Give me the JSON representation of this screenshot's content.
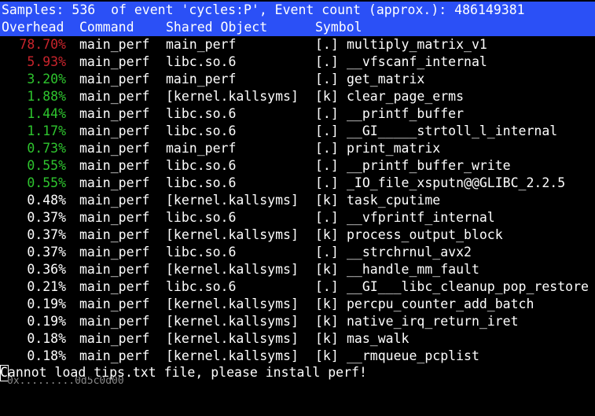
{
  "header": {
    "summary": "Samples: 536  of event 'cycles:P', Event count (approx.): 486149381"
  },
  "columns": {
    "overhead": "Overhead",
    "command": "Command",
    "shared_object": "Shared Object",
    "symbol": "Symbol"
  },
  "colors": {
    "header_bg": "#2b50f6",
    "hot": "#c8242c",
    "warm": "#2ec42e",
    "normal": "#ffffff",
    "background": "#000000"
  },
  "rows": [
    {
      "overhead": "78.70%",
      "command": "main_perf",
      "object": "main_perf",
      "level": "[.]",
      "symbol": "multiply_matrix_v1",
      "heat": "hot"
    },
    {
      "overhead": "5.93%",
      "command": "main_perf",
      "object": "libc.so.6",
      "level": "[.]",
      "symbol": "__vfscanf_internal",
      "heat": "hot"
    },
    {
      "overhead": "3.20%",
      "command": "main_perf",
      "object": "main_perf",
      "level": "[.]",
      "symbol": "get_matrix",
      "heat": "warm"
    },
    {
      "overhead": "1.88%",
      "command": "main_perf",
      "object": "[kernel.kallsyms]",
      "level": "[k]",
      "symbol": "clear_page_erms",
      "heat": "warm"
    },
    {
      "overhead": "1.44%",
      "command": "main_perf",
      "object": "libc.so.6",
      "level": "[.]",
      "symbol": "__printf_buffer",
      "heat": "warm"
    },
    {
      "overhead": "1.17%",
      "command": "main_perf",
      "object": "libc.so.6",
      "level": "[.]",
      "symbol": "__GI_____strtoll_l_internal",
      "heat": "warm"
    },
    {
      "overhead": "0.73%",
      "command": "main_perf",
      "object": "main_perf",
      "level": "[.]",
      "symbol": "print_matrix",
      "heat": "warm"
    },
    {
      "overhead": "0.55%",
      "command": "main_perf",
      "object": "libc.so.6",
      "level": "[.]",
      "symbol": "__printf_buffer_write",
      "heat": "warm"
    },
    {
      "overhead": "0.55%",
      "command": "main_perf",
      "object": "libc.so.6",
      "level": "[.]",
      "symbol": "_IO_file_xsputn@@GLIBC_2.2.5",
      "heat": "warm"
    },
    {
      "overhead": "0.48%",
      "command": "main_perf",
      "object": "[kernel.kallsyms]",
      "level": "[k]",
      "symbol": "task_cputime",
      "heat": "normal"
    },
    {
      "overhead": "0.37%",
      "command": "main_perf",
      "object": "libc.so.6",
      "level": "[.]",
      "symbol": "__vfprintf_internal",
      "heat": "normal"
    },
    {
      "overhead": "0.37%",
      "command": "main_perf",
      "object": "[kernel.kallsyms]",
      "level": "[k]",
      "symbol": "process_output_block",
      "heat": "normal"
    },
    {
      "overhead": "0.37%",
      "command": "main_perf",
      "object": "libc.so.6",
      "level": "[.]",
      "symbol": "__strchrnul_avx2",
      "heat": "normal"
    },
    {
      "overhead": "0.36%",
      "command": "main_perf",
      "object": "[kernel.kallsyms]",
      "level": "[k]",
      "symbol": "__handle_mm_fault",
      "heat": "normal"
    },
    {
      "overhead": "0.21%",
      "command": "main_perf",
      "object": "libc.so.6",
      "level": "[.]",
      "symbol": "__GI___libc_cleanup_pop_restore",
      "heat": "normal"
    },
    {
      "overhead": "0.19%",
      "command": "main_perf",
      "object": "[kernel.kallsyms]",
      "level": "[k]",
      "symbol": "percpu_counter_add_batch",
      "heat": "normal"
    },
    {
      "overhead": "0.19%",
      "command": "main_perf",
      "object": "[kernel.kallsyms]",
      "level": "[k]",
      "symbol": "native_irq_return_iret",
      "heat": "normal"
    },
    {
      "overhead": "0.18%",
      "command": "main_perf",
      "object": "[kernel.kallsyms]",
      "level": "[k]",
      "symbol": "mas_walk",
      "heat": "normal"
    },
    {
      "overhead": "0.18%",
      "command": "main_perf",
      "object": "[kernel.kallsyms]",
      "level": "[k]",
      "symbol": "__rmqueue_pcplist",
      "heat": "normal"
    }
  ],
  "status": {
    "message": "Cannot load tips.txt file, please install perf!",
    "ghost_text": "0x.........0d5c0d00"
  }
}
